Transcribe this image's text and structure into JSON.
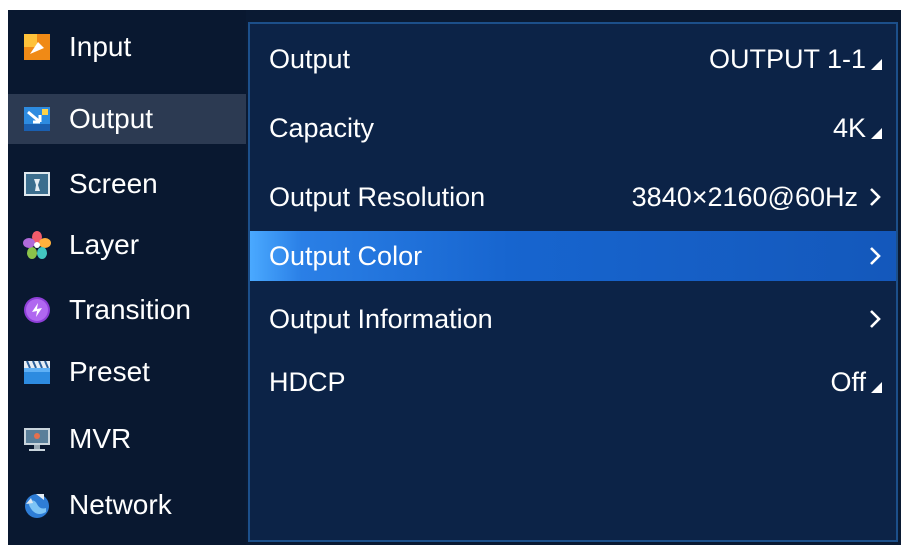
{
  "sidebar": {
    "items": [
      {
        "label": "Input",
        "icon": "input-icon"
      },
      {
        "label": "Output",
        "icon": "output-icon"
      },
      {
        "label": "Screen",
        "icon": "screen-icon"
      },
      {
        "label": "Layer",
        "icon": "layer-icon"
      },
      {
        "label": "Transition",
        "icon": "transition-icon"
      },
      {
        "label": "Preset",
        "icon": "preset-icon"
      },
      {
        "label": "MVR",
        "icon": "mvr-icon"
      },
      {
        "label": "Network",
        "icon": "network-icon"
      }
    ],
    "active": "Output"
  },
  "main": {
    "rows": [
      {
        "label": "Output",
        "value": "OUTPUT 1-1",
        "indicator": "dropdown-triangle"
      },
      {
        "label": "Capacity",
        "value": "4K",
        "indicator": "dropdown-triangle"
      },
      {
        "label": "Output Resolution",
        "value": "3840×2160@60Hz",
        "indicator": "chevron-right"
      },
      {
        "label": "Output Color",
        "value": "",
        "indicator": "chevron-right"
      },
      {
        "label": "Output Information",
        "value": "",
        "indicator": "chevron-right"
      },
      {
        "label": "HDCP",
        "value": "Off",
        "indicator": "dropdown-triangle"
      }
    ],
    "selected": "Output Color"
  },
  "colors": {
    "background": "#0a1a33",
    "panel": "#0c2347",
    "panel_border": "#1c4f8a",
    "active_sidebar": "#2c3a52",
    "selection": "#1765cf",
    "text": "#ffffff"
  }
}
